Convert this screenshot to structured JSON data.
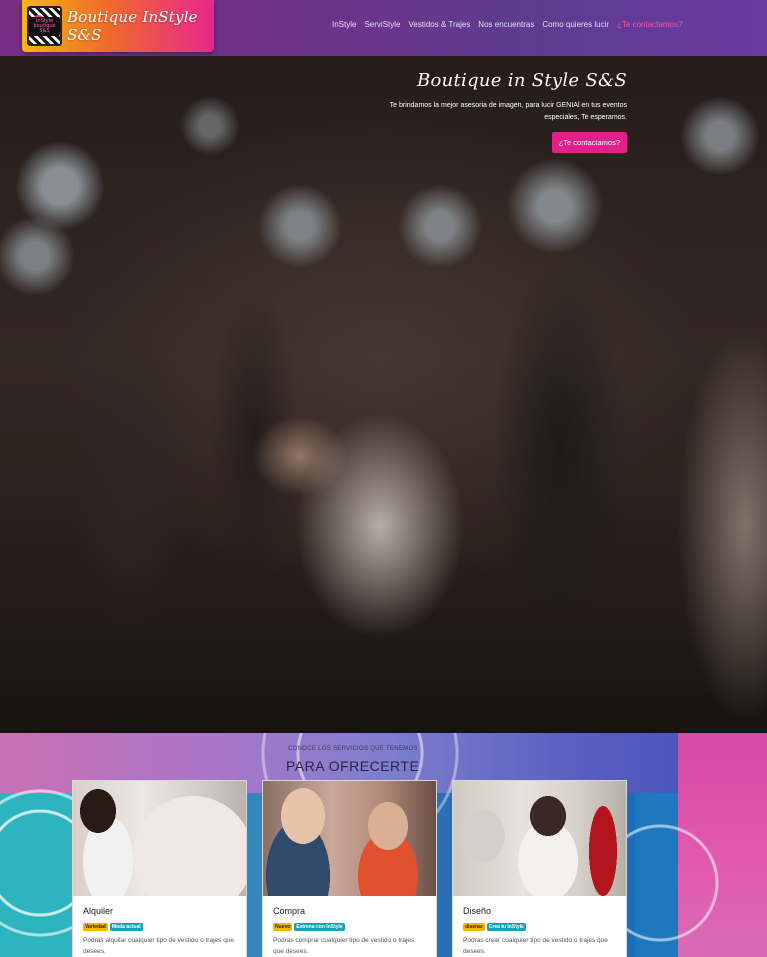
{
  "brand": {
    "name": "Boutique InStyle S&S",
    "logo_text": "InStyle boutique S&S"
  },
  "nav": {
    "links": [
      "InStyle",
      "ServiStyle",
      "Vestidos & Trajes",
      "Nos encuentras",
      "Como quieres lucir",
      "¿Te contactamos?"
    ]
  },
  "hero": {
    "title": "Boutique in Style S&S",
    "description_line1": "Te brindamos la mejor asesoria de imagen, para lucir GENIAl en tus eventos",
    "description_line2": "especiales, Te esperamos.",
    "cta": "¿Te contactamos?"
  },
  "services": {
    "subtitle": "CONOCE LOS SERVICIOS QUE TENEMOS",
    "title": "PARA OFRECERTE",
    "cards": [
      {
        "title": "Alquiler",
        "badge1": "Variedad",
        "badge2": "Moda actual",
        "text": "Podras alquilar cualquier tipo de vestido o trajes que desees."
      },
      {
        "title": "Compra",
        "badge1": "Nuevo",
        "badge2": "Estrena con InStyle",
        "text": "Podras comprar cualquier tipo de vestido o trajes que desees."
      },
      {
        "title": "Diseño",
        "badge1": "disenar",
        "badge2": "Crea tu InStyle",
        "text": "Podras crear cualquier tipo de vestido o trajes que desees."
      }
    ]
  },
  "colors": {
    "accent": "#e0218a",
    "nav_active": "#ff4fae",
    "badge_warn": "#f4b400",
    "badge_info": "#17a2b8"
  }
}
